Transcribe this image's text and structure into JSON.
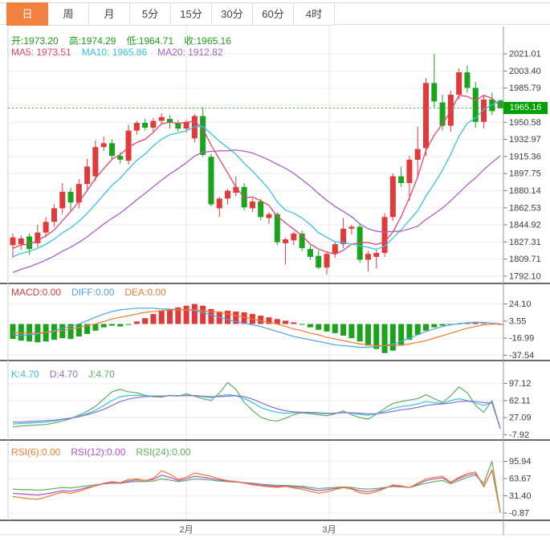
{
  "toolbar": {
    "tabs": [
      {
        "name": "day",
        "label": "日",
        "active": true
      },
      {
        "name": "week",
        "label": "周",
        "active": false
      },
      {
        "name": "month",
        "label": "月",
        "active": false
      },
      {
        "name": "5min",
        "label": "5分",
        "active": false
      },
      {
        "name": "15min",
        "label": "15分",
        "active": false
      },
      {
        "name": "30min",
        "label": "30分",
        "active": false
      },
      {
        "name": "60min",
        "label": "60分",
        "active": false
      },
      {
        "name": "4hour",
        "label": "4时",
        "active": false
      }
    ]
  },
  "readouts": {
    "ohlc": [
      {
        "text": "开:1973.20",
        "color": "#1ca11c"
      },
      {
        "text": "高:1974.29",
        "color": "#1ca11c"
      },
      {
        "text": "低:1964.71",
        "color": "#1ca11c"
      },
      {
        "text": "收:1965.16",
        "color": "#1ca11c"
      }
    ],
    "ma": [
      {
        "text": "MA5: 1973.51",
        "color": "#e6446e"
      },
      {
        "text": "MA10: 1965.86",
        "color": "#36c3e4"
      },
      {
        "text": "MA20: 1912.82",
        "color": "#ab5fc6"
      }
    ],
    "macd": [
      {
        "text": "MACD:0.00",
        "color": "#e03a3a"
      },
      {
        "text": "DIFF:0.00",
        "color": "#4da3e8"
      },
      {
        "text": "DEA:0.00",
        "color": "#f07c2e"
      }
    ],
    "kdj": [
      {
        "text": "K:4.70",
        "color": "#2fc4de"
      },
      {
        "text": "D:4.70",
        "color": "#8e6ed0"
      },
      {
        "text": "J:4.70",
        "color": "#5fae5f"
      }
    ],
    "rsi": [
      {
        "text": "RSI(6):0.00",
        "color": "#f07c2e"
      },
      {
        "text": "RSI(12):0.00",
        "color": "#b44fc8"
      },
      {
        "text": "RSI(24):0.00",
        "color": "#5fae5f"
      }
    ]
  },
  "colors": {
    "up": "#e03a3a",
    "down": "#1ca31c",
    "ma5": "#e6446e",
    "ma10": "#36c3e4",
    "ma20": "#ab5fc6",
    "diff": "#4da3e8",
    "dea": "#f07c2e",
    "k": "#2fc4de",
    "d": "#8e6ed0",
    "j": "#5fae5f",
    "rsi6": "#f07c2e",
    "rsi12": "#b44fc8",
    "rsi24": "#5fae5f",
    "price_line": "#2fae2f",
    "badge_bg": "#00a000",
    "accent_tab": "#f0813e"
  },
  "chart_data": {
    "type": "candlestick-multi-panel",
    "x_labels": [
      {
        "t": "2月",
        "i": 21
      },
      {
        "t": "3月",
        "i": 38.3
      }
    ],
    "main": {
      "type": "candlestick",
      "ylim": [
        1784.6,
        2049.2
      ],
      "current_price": {
        "v": 1965.16,
        "t": "1965.16"
      },
      "levels": [
        {
          "v": 2021.01,
          "t": "2021.01"
        },
        {
          "v": 2003.4,
          "t": "2003.40"
        },
        {
          "v": 1985.79,
          "t": "1985.79"
        },
        {
          "v": 1968.18,
          "t": null
        },
        {
          "v": 1950.58,
          "t": "1950.58"
        },
        {
          "v": 1932.97,
          "t": "1932.97"
        },
        {
          "v": 1915.36,
          "t": "1915.36"
        },
        {
          "v": 1897.75,
          "t": "1897.75"
        },
        {
          "v": 1880.14,
          "t": "1880.14"
        },
        {
          "v": 1862.53,
          "t": "1862.53"
        },
        {
          "v": 1844.92,
          "t": "1844.92"
        },
        {
          "v": 1827.31,
          "t": "1827.31"
        },
        {
          "v": 1809.71,
          "t": "1809.71"
        },
        {
          "v": 1792.1,
          "t": "1792.10"
        }
      ],
      "candles": [
        [
          1824,
          1836,
          1811,
          1832
        ],
        [
          1825,
          1834,
          1819,
          1831
        ],
        [
          1833,
          1836,
          1814,
          1820
        ],
        [
          1826,
          1845,
          1822,
          1837
        ],
        [
          1837,
          1853,
          1832,
          1848
        ],
        [
          1848,
          1866,
          1843,
          1862
        ],
        [
          1862,
          1888,
          1856,
          1879
        ],
        [
          1879,
          1883,
          1859,
          1868
        ],
        [
          1868,
          1892,
          1862,
          1887
        ],
        [
          1887,
          1913,
          1881,
          1905
        ],
        [
          1895,
          1932,
          1890,
          1925
        ],
        [
          1925,
          1936,
          1921,
          1929
        ],
        [
          1929,
          1933,
          1913,
          1916
        ],
        [
          1916,
          1920,
          1908,
          1912
        ],
        [
          1911,
          1948,
          1907,
          1942
        ],
        [
          1942,
          1952,
          1938,
          1950
        ],
        [
          1950,
          1954,
          1942,
          1945
        ],
        [
          1945,
          1955,
          1941,
          1952
        ],
        [
          1952,
          1960,
          1948,
          1956
        ],
        [
          1954,
          1958,
          1944,
          1950
        ],
        [
          1950,
          1953,
          1941,
          1944
        ],
        [
          1944,
          1953,
          1940,
          1951
        ],
        [
          1934,
          1959,
          1930,
          1957
        ],
        [
          1957,
          1966,
          1915,
          1917
        ],
        [
          1915,
          1918,
          1864,
          1866
        ],
        [
          1862,
          1874,
          1853,
          1872
        ],
        [
          1872,
          1882,
          1866,
          1880
        ],
        [
          1878,
          1895,
          1874,
          1884
        ],
        [
          1884,
          1888,
          1860,
          1863
        ],
        [
          1862,
          1872,
          1858,
          1869
        ],
        [
          1869,
          1872,
          1850,
          1853
        ],
        [
          1852,
          1858,
          1846,
          1856
        ],
        [
          1856,
          1858,
          1824,
          1827
        ],
        [
          1826,
          1832,
          1804,
          1830
        ],
        [
          1829,
          1838,
          1824,
          1836
        ],
        [
          1836,
          1839,
          1818,
          1821
        ],
        [
          1820,
          1824,
          1809,
          1812
        ],
        [
          1813,
          1819,
          1799,
          1801
        ],
        [
          1801,
          1817,
          1794,
          1815
        ],
        [
          1815,
          1827,
          1811,
          1825
        ],
        [
          1825,
          1852,
          1821,
          1841
        ],
        [
          1841,
          1845,
          1835,
          1843
        ],
        [
          1843,
          1846,
          1806,
          1809
        ],
        [
          1809,
          1818,
          1797,
          1815
        ],
        [
          1812,
          1820,
          1800,
          1816
        ],
        [
          1816,
          1857,
          1812,
          1853
        ],
        [
          1853,
          1898,
          1849,
          1895
        ],
        [
          1895,
          1905,
          1884,
          1888
        ],
        [
          1888,
          1916,
          1870,
          1912
        ],
        [
          1912,
          1946,
          1893,
          1923
        ],
        [
          1924,
          1996,
          1916,
          1991
        ],
        [
          1991,
          2021,
          1966,
          1972
        ],
        [
          1971,
          1979,
          1942,
          1947
        ],
        [
          1947,
          1983,
          1941,
          1979
        ],
        [
          1979,
          2006,
          1974,
          2002
        ],
        [
          2002,
          2009,
          1981,
          1986
        ],
        [
          1986,
          1992,
          1945,
          1951
        ],
        [
          1951,
          1978,
          1944,
          1974
        ],
        [
          1974,
          1981,
          1958,
          1962
        ],
        [
          1973.2,
          1974.29,
          1964.71,
          1965.16
        ]
      ]
    },
    "macd": {
      "type": "bar+line",
      "levels": [
        {
          "v": 24.1,
          "t": "24.10"
        },
        {
          "v": 3.55,
          "t": "3.55"
        },
        {
          "v": -16.99,
          "t": "-16.99"
        },
        {
          "v": -37.54,
          "t": "-37.54"
        }
      ],
      "hist": [
        -18,
        -20,
        -21,
        -22,
        -21,
        -19,
        -17,
        -18,
        -15,
        -12,
        -8,
        -4,
        -2,
        -3,
        -1,
        3,
        7,
        12,
        16,
        18,
        20,
        22,
        24,
        22,
        18,
        15,
        16,
        15,
        14,
        12,
        10,
        8,
        6,
        4,
        2,
        -1,
        -4,
        -7,
        -9,
        -11,
        -14,
        -17,
        -21,
        -26,
        -30,
        -35,
        -32,
        -26,
        -19,
        -13,
        -8,
        -4,
        -2,
        -1,
        0.5,
        1.5,
        2.5,
        1,
        0.3,
        0
      ],
      "diff": [
        -13,
        -14,
        -13,
        -12,
        -10,
        -8,
        -5,
        -3,
        0,
        4,
        8,
        12,
        15,
        17,
        18,
        19,
        19,
        19,
        18,
        18,
        17,
        17,
        16,
        14,
        11,
        8,
        5,
        3,
        1,
        -1,
        -3,
        -6,
        -9,
        -12,
        -15,
        -17,
        -19,
        -21,
        -23,
        -25,
        -26,
        -27,
        -28,
        -28,
        -27,
        -26,
        -24,
        -21,
        -17,
        -13,
        -9,
        -6,
        -3,
        -1,
        0.5,
        1.5,
        2,
        2,
        1,
        0
      ],
      "dea": [
        -10,
        -11,
        -11,
        -11,
        -10,
        -9,
        -8,
        -6,
        -4,
        -2,
        0,
        3,
        6,
        8,
        10,
        12,
        14,
        15,
        16,
        17,
        17,
        17,
        17,
        16,
        15,
        14,
        12,
        10,
        8,
        6,
        4,
        2,
        0,
        -3,
        -6,
        -8,
        -11,
        -13,
        -16,
        -18,
        -20,
        -22,
        -24,
        -25,
        -26,
        -26,
        -26,
        -25,
        -24,
        -22,
        -20,
        -17,
        -14,
        -11,
        -8,
        -5,
        -3,
        -1,
        0,
        0
      ]
    },
    "kdj": {
      "type": "line",
      "levels": [
        {
          "v": 97.12,
          "t": "97.12"
        },
        {
          "v": 62.11,
          "t": "62.11"
        },
        {
          "v": 27.09,
          "t": "27.09"
        },
        {
          "v": -7.92,
          "t": "-7.92"
        }
      ],
      "k": [
        14,
        15,
        16,
        17,
        18,
        20,
        23,
        26,
        30,
        35,
        42,
        52,
        62,
        70,
        72,
        73,
        72,
        71,
        71,
        72,
        72,
        73,
        72,
        70,
        68,
        72,
        74,
        72,
        66,
        58,
        48,
        42,
        38,
        36,
        37,
        38,
        37,
        36,
        35,
        36,
        38,
        36,
        34,
        32,
        35,
        40,
        46,
        50,
        52,
        55,
        60,
        58,
        56,
        62,
        66,
        62,
        57,
        52,
        58,
        4.7
      ],
      "d": [
        18,
        18,
        19,
        20,
        21,
        22,
        24,
        26,
        29,
        33,
        38,
        44,
        52,
        60,
        65,
        68,
        70,
        71,
        71,
        72,
        72,
        72,
        72,
        71,
        70,
        70,
        71,
        72,
        70,
        65,
        58,
        51,
        45,
        41,
        39,
        38,
        38,
        37,
        36,
        36,
        37,
        37,
        36,
        35,
        35,
        37,
        40,
        43,
        45,
        48,
        52,
        54,
        55,
        57,
        60,
        61,
        60,
        58,
        57,
        4.7
      ],
      "j": [
        8,
        10,
        11,
        12,
        13,
        16,
        20,
        25,
        32,
        40,
        50,
        65,
        80,
        85,
        80,
        78,
        73,
        70,
        69,
        73,
        71,
        76,
        71,
        66,
        62,
        78,
        99,
        85,
        58,
        42,
        28,
        22,
        20,
        26,
        33,
        37,
        35,
        33,
        31,
        35,
        41,
        33,
        27,
        24,
        34,
        46,
        56,
        60,
        63,
        66,
        74,
        66,
        58,
        72,
        90,
        78,
        52,
        38,
        62,
        4.7
      ]
    },
    "rsi": {
      "type": "line",
      "levels": [
        {
          "v": 95.94,
          "t": "95.94"
        },
        {
          "v": 63.67,
          "t": "63.67"
        },
        {
          "v": 31.4,
          "t": "31.40"
        },
        {
          "v": -0.87,
          "t": "-0.87"
        }
      ],
      "r6": [
        30,
        28,
        26,
        25,
        29,
        34,
        38,
        36,
        40,
        45,
        50,
        55,
        58,
        56,
        62,
        63,
        60,
        64,
        78,
        72,
        62,
        66,
        74,
        71,
        68,
        63,
        60,
        58,
        55,
        52,
        50,
        48,
        47,
        49,
        46,
        44,
        40,
        36,
        39,
        43,
        47,
        44,
        37,
        35,
        39,
        45,
        52,
        50,
        47,
        55,
        63,
        66,
        68,
        57,
        66,
        73,
        76,
        48,
        80,
        0
      ],
      "r12": [
        36,
        35,
        34,
        33,
        35,
        38,
        41,
        40,
        43,
        47,
        50,
        54,
        56,
        55,
        59,
        61,
        60,
        62,
        70,
        66,
        60,
        63,
        68,
        66,
        64,
        61,
        59,
        58,
        56,
        54,
        52,
        50,
        49,
        50,
        48,
        47,
        44,
        41,
        43,
        45,
        47,
        45,
        41,
        39,
        42,
        46,
        50,
        49,
        47,
        53,
        60,
        63,
        65,
        56,
        64,
        70,
        73,
        50,
        79,
        0
      ],
      "r24": [
        44,
        43,
        43,
        42,
        43,
        45,
        47,
        46,
        48,
        50,
        52,
        54,
        55,
        55,
        57,
        58,
        58,
        59,
        63,
        61,
        58,
        60,
        63,
        62,
        61,
        59,
        58,
        57,
        56,
        55,
        53,
        52,
        51,
        51,
        50,
        49,
        47,
        45,
        46,
        47,
        48,
        47,
        45,
        44,
        45,
        47,
        49,
        48,
        47,
        51,
        55,
        58,
        60,
        54,
        60,
        66,
        70,
        55,
        96,
        0
      ]
    }
  }
}
